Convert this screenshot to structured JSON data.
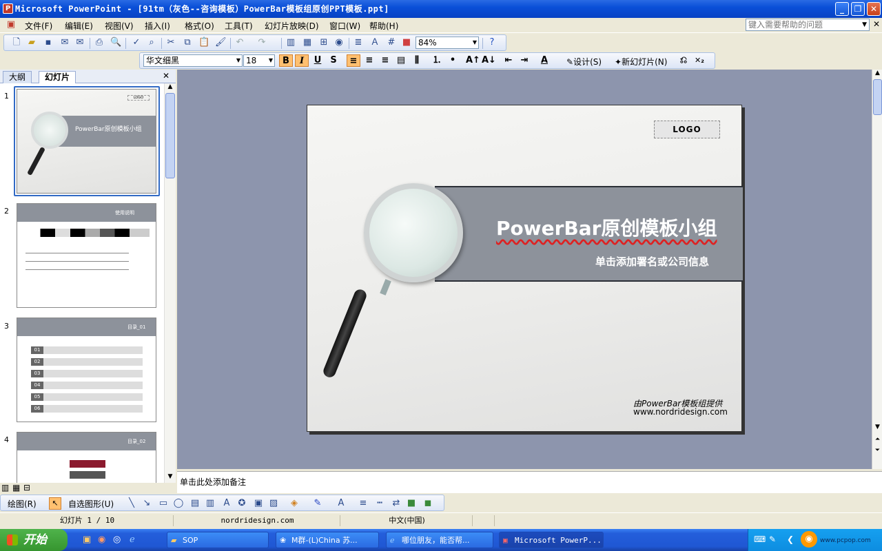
{
  "window": {
    "title": "Microsoft PowerPoint - [91tm（灰色--咨询模板）PowerBar模板组原创PPT模板.ppt]",
    "app_letter": "P"
  },
  "menu": [
    "文件(F)",
    "编辑(E)",
    "视图(V)",
    "插入(I)",
    "格式(O)",
    "工具(T)",
    "幻灯片放映(D)",
    "窗口(W)",
    "帮助(H)"
  ],
  "help_placeholder": "键入需要帮助的问题",
  "standard_toolbar": {
    "zoom": "84%"
  },
  "format_toolbar": {
    "font": "华文细黑",
    "size": "18",
    "bold": "B",
    "italic": "I",
    "underline": "U",
    "shadow": "S",
    "design": "设计(S)",
    "new_slide": "新幻灯片(N)"
  },
  "pane_tabs": {
    "outline": "大纲",
    "slides": "幻灯片"
  },
  "thumbnails": [
    {
      "num": "1",
      "title": "PowerBar原创模板小组"
    },
    {
      "num": "2",
      "title": "使用说明"
    },
    {
      "num": "3",
      "title": "目录_01",
      "items": [
        "01",
        "02",
        "03",
        "04",
        "05",
        "06"
      ]
    },
    {
      "num": "4",
      "title": "目录_02"
    }
  ],
  "slide": {
    "logo": "LOGO",
    "title": "PowerBar原创模板小组",
    "subtitle": "单击添加署名或公司信息",
    "credit_line1": "由PowerBar模板组提供",
    "credit_line2": "www.nordridesign.com"
  },
  "notes_placeholder": "单击此处添加备注",
  "drawing_toolbar": {
    "draw": "绘图(R)",
    "autoshapes": "自选图形(U)"
  },
  "status": {
    "slide_count": "幻灯片 1 / 10",
    "design": "nordridesign.com",
    "language": "中文(中国)"
  },
  "taskbar": {
    "start": "开始",
    "items": [
      "SOP",
      "M群-(L)China 苏...",
      "哪位朋友，能否帮...",
      "Microsoft PowerP..."
    ],
    "watermark": "www.pcpop.com"
  },
  "colors": {
    "titlebar": "#0a4fd8",
    "slide_band": "#8d929b",
    "workspace": "#8d95ad"
  }
}
